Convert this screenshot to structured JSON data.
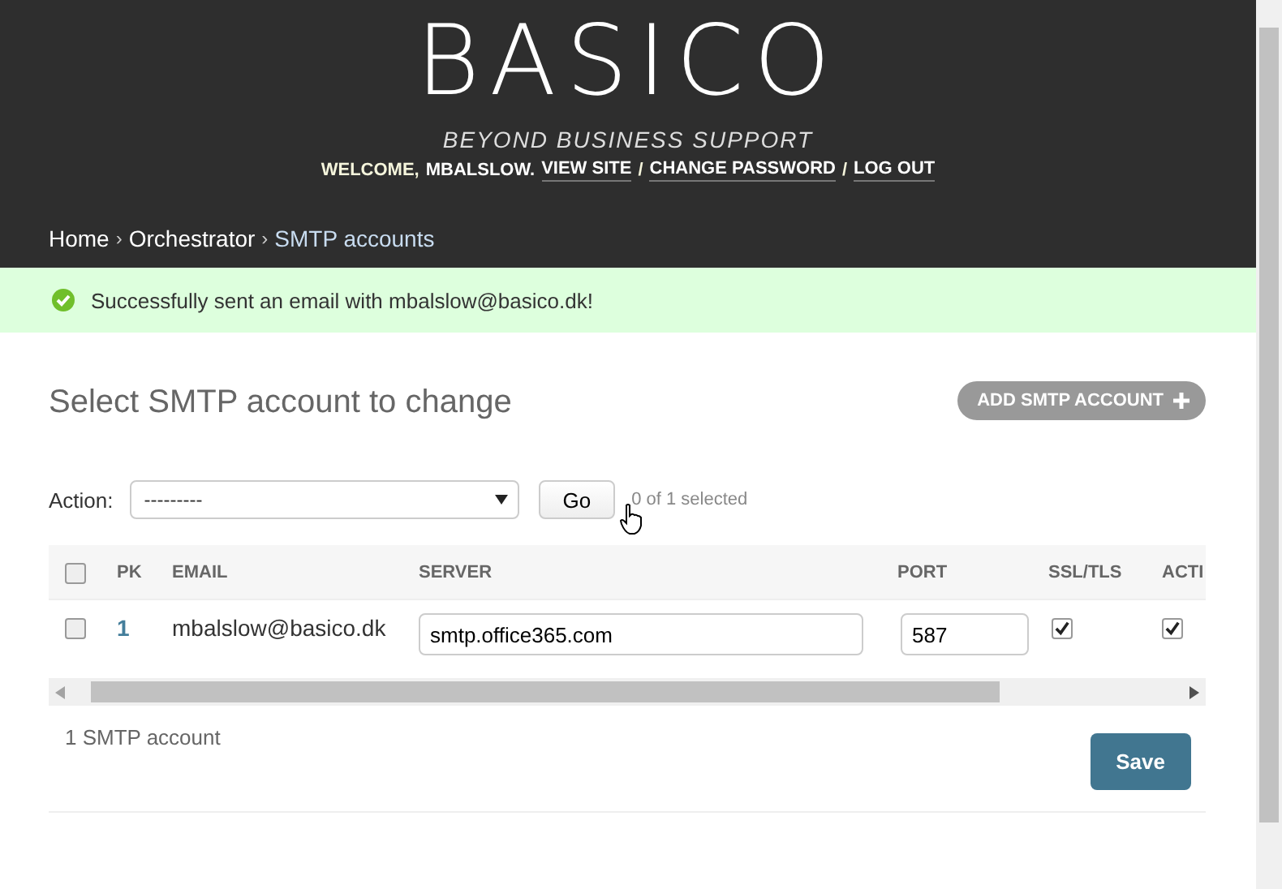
{
  "header": {
    "logo": "BASICO",
    "tagline": "BEYOND BUSINESS SUPPORT",
    "welcome": "WELCOME,",
    "username": "MBALSLOW.",
    "links": [
      {
        "kind": "link",
        "label": "VIEW SITE"
      },
      {
        "kind": "separator",
        "label": "/"
      },
      {
        "kind": "link",
        "label": "CHANGE PASSWORD"
      },
      {
        "kind": "separator",
        "label": "/"
      },
      {
        "kind": "link",
        "label": "LOG OUT"
      }
    ]
  },
  "breadcrumbs": [
    {
      "kind": "link",
      "label": "Home",
      "current": false
    },
    {
      "kind": "separator",
      "label": "›"
    },
    {
      "kind": "link",
      "label": "Orchestrator",
      "current": false
    },
    {
      "kind": "separator",
      "label": "›"
    },
    {
      "kind": "link",
      "label": "SMTP accounts",
      "current": true
    }
  ],
  "message": {
    "kind": "success",
    "text": "Successfully sent an email with mbalslow@basico.dk!"
  },
  "title": "Select SMTP account to change",
  "add_button": "ADD SMTP ACCOUNT",
  "actions": {
    "label": "Action:",
    "value": "---------",
    "go": "Go",
    "counter": "0 of 1 selected"
  },
  "table": {
    "select_all": false,
    "columns": [
      "PK",
      "EMAIL",
      "SERVER",
      "PORT",
      "SSL/TLS",
      "ACTI"
    ],
    "rows": [
      {
        "selected": false,
        "pk": "1",
        "email": "mbalslow@basico.dk",
        "server": "smtp.office365.com",
        "port": "587",
        "ssl_tls": true,
        "active": true
      }
    ]
  },
  "paginator": "1 SMTP account",
  "save_button": "Save"
}
